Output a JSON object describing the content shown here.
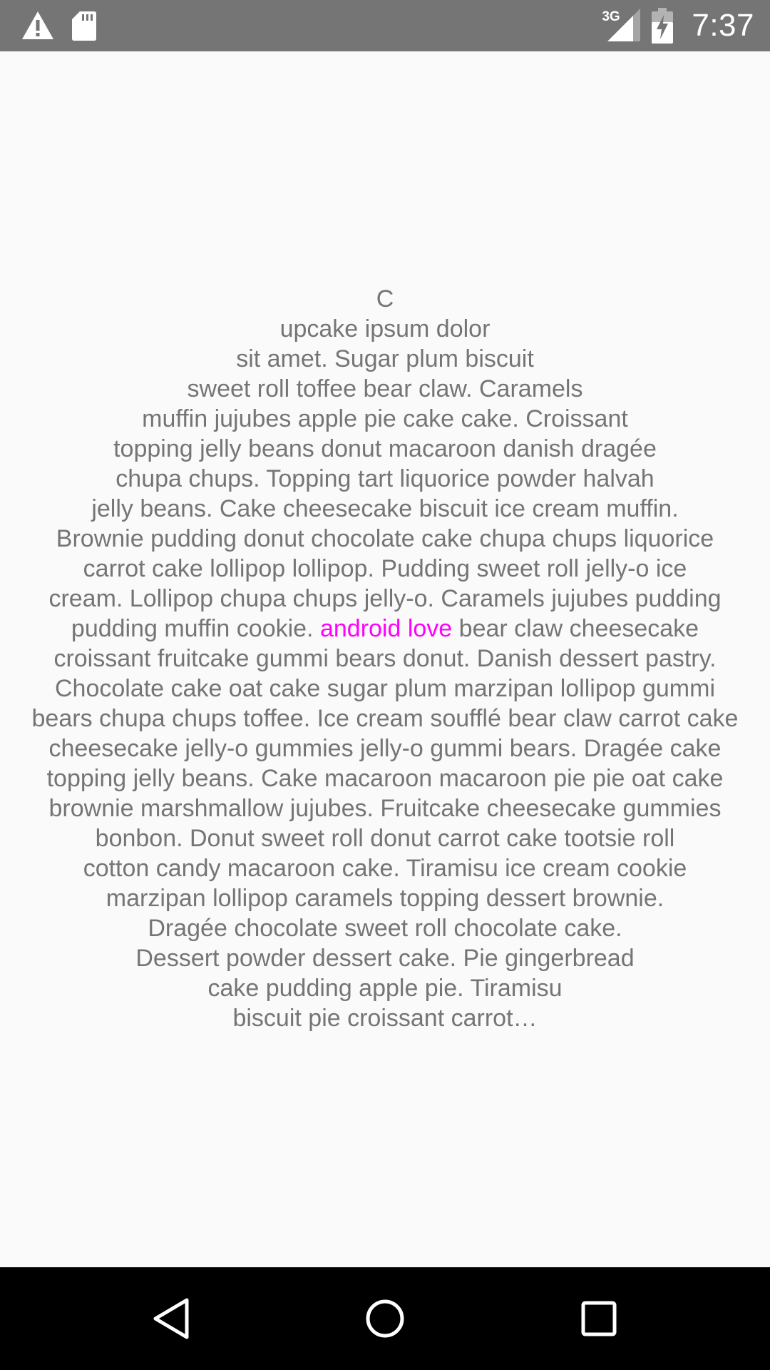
{
  "status_bar": {
    "time": "7:37",
    "network_type": "3G",
    "left_icons": [
      "warning-icon",
      "sd-card-icon"
    ],
    "right_icons": [
      "signal-icon",
      "battery-charging-icon"
    ],
    "background_color": "#757575"
  },
  "body_text": {
    "text_color": "#757575",
    "highlight_color": "#ff00ff",
    "lines": [
      "C",
      "upcake ipsum dolor",
      "sit amet. Sugar plum biscuit",
      "sweet roll toffee bear claw. Caramels",
      "muffin jujubes apple pie cake cake. Croissant",
      "topping jelly beans donut macaroon danish dragée",
      "chupa chups. Topping tart liquorice powder halvah",
      "jelly beans. Cake cheesecake biscuit ice cream muffin.",
      "Brownie pudding donut chocolate cake chupa chups liquorice",
      "carrot cake lollipop lollipop. Pudding sweet roll jelly-o ice",
      "cream. Lollipop chupa chups jelly-o. Caramels jujubes pudding"
    ],
    "highlight_line": {
      "before": "pudding muffin cookie. ",
      "highlight": "android love",
      "after": " bear claw cheesecake"
    },
    "lines_after": [
      "croissant fruitcake gummi bears donut. Danish dessert pastry.",
      "Chocolate cake oat cake sugar plum marzipan lollipop gummi",
      "bears chupa chups toffee. Ice cream soufflé bear claw carrot cake",
      "cheesecake jelly-o gummies jelly-o gummi bears. Dragée cake",
      "topping jelly beans. Cake macaroon macaroon pie pie oat cake",
      "brownie marshmallow jujubes. Fruitcake cheesecake gummies",
      "bonbon. Donut sweet roll donut carrot cake tootsie roll",
      "cotton candy macaroon cake. Tiramisu ice cream cookie",
      "marzipan lollipop caramels topping dessert brownie.",
      "Dragée chocolate sweet roll chocolate cake.",
      "Dessert powder dessert cake. Pie gingerbread",
      "cake pudding apple pie. Tiramisu",
      "biscuit pie croissant carrot…"
    ]
  },
  "nav_bar": {
    "buttons": [
      "back-icon",
      "home-icon",
      "recents-icon"
    ],
    "background_color": "#000000"
  }
}
